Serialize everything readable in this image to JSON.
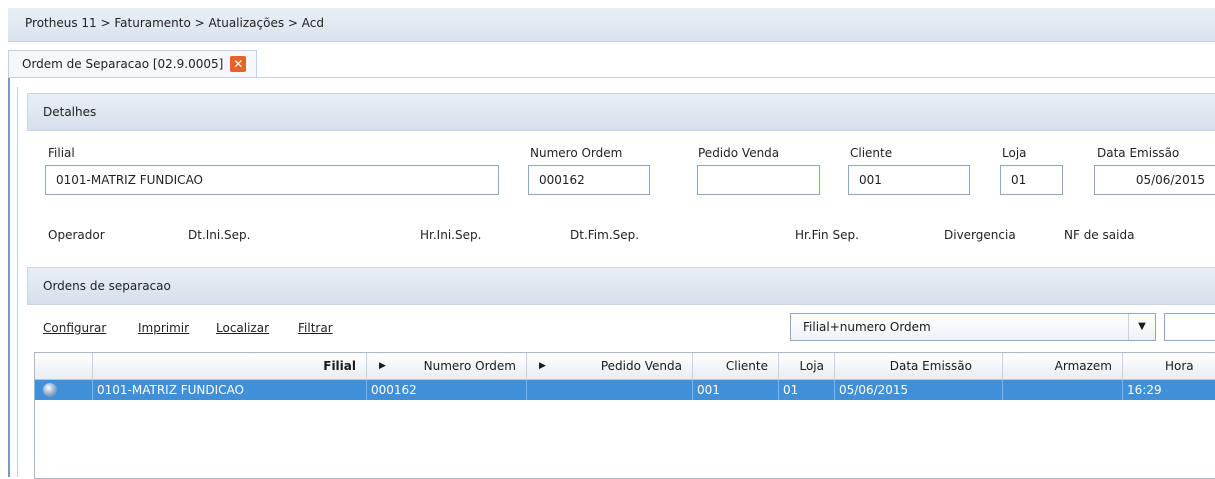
{
  "breadcrumb": "Protheus 11 > Faturamento > Atualizações > Acd",
  "tab": {
    "label": "Ordem de Separacao [02.9.0005]",
    "close_glyph": "✕"
  },
  "details": {
    "title": "Detalhes",
    "filial": {
      "label": "Filial",
      "value": "0101-MATRIZ FUNDICAO"
    },
    "numero_ordem": {
      "label": "Numero Ordem",
      "value": "000162"
    },
    "pedido_venda": {
      "label": "Pedido Venda",
      "value": ""
    },
    "cliente": {
      "label": "Cliente",
      "value": "001"
    },
    "loja": {
      "label": "Loja",
      "value": "01"
    },
    "data_emissao": {
      "label": "Data Emissão",
      "value": "05/06/2015"
    },
    "row2_labels": [
      "Operador",
      "Dt.Ini.Sep.",
      "Hr.Ini.Sep.",
      "Dt.Fim.Sep.",
      "Hr.Fin Sep.",
      "Divergencia",
      "NF de saida"
    ]
  },
  "orders": {
    "title": "Ordens de separacao",
    "actions": [
      "Configurar",
      "Imprimir",
      "Localizar",
      "Filtrar"
    ],
    "sort_selected": "Filial+numero Ordem",
    "columns": [
      "",
      "Filial",
      "Numero Ordem",
      "Pedido Venda",
      "Cliente",
      "Loja",
      "Data Emissão",
      "Armazem",
      "Hora Em"
    ],
    "rows": [
      [
        "",
        "0101-MATRIZ FUNDICAO",
        "000162",
        "",
        "001",
        "01",
        "05/06/2015",
        "",
        "16:29"
      ]
    ]
  },
  "colors": {
    "accent": "#3f8fd9",
    "close": "#e8632a"
  }
}
